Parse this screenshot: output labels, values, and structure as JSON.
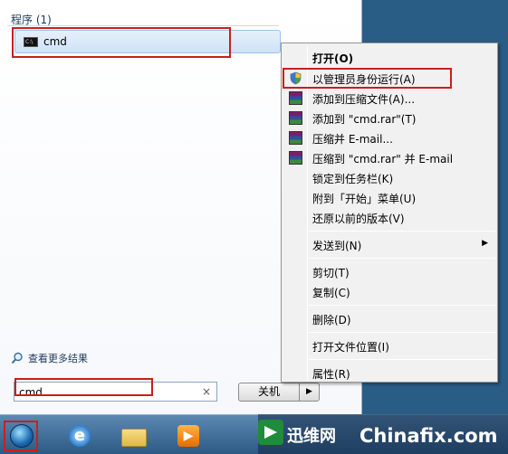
{
  "start_menu": {
    "programs_header": "程序 (1)",
    "program_item": {
      "icon_text": "C:\\",
      "label": "cmd"
    },
    "more_results": "查看更多结果",
    "search": {
      "value": "cmd",
      "clear": "×"
    },
    "shutdown": {
      "label": "关机",
      "arrow": "▶"
    }
  },
  "context_menu": {
    "items": [
      {
        "label": "打开(O)",
        "icon": "",
        "bold": true
      },
      {
        "label": "以管理员身份运行(A)",
        "icon": "shield-icon"
      },
      {
        "label": "添加到压缩文件(A)...",
        "icon": "winrar-icon"
      },
      {
        "label": "添加到 \"cmd.rar\"(T)",
        "icon": "winrar-icon"
      },
      {
        "label": "压缩并 E-mail...",
        "icon": "winrar-icon"
      },
      {
        "label": "压缩到 \"cmd.rar\" 并 E-mail",
        "icon": "winrar-icon"
      },
      {
        "label": "锁定到任务栏(K)",
        "icon": ""
      },
      {
        "label": "附到「开始」菜单(U)",
        "icon": ""
      },
      {
        "label": "还原以前的版本(V)",
        "icon": ""
      },
      {
        "label": "发送到(N)",
        "icon": "",
        "submenu": "▶"
      },
      {
        "label": "剪切(T)",
        "icon": ""
      },
      {
        "label": "复制(C)",
        "icon": ""
      },
      {
        "label": "删除(D)",
        "icon": ""
      },
      {
        "label": "打开文件位置(I)",
        "icon": ""
      },
      {
        "label": "属性(R)",
        "icon": ""
      }
    ]
  },
  "taskbar": {
    "ie_glyph": "e",
    "media_glyph": "▶"
  },
  "watermark": {
    "brand_cn": "迅维网",
    "brand_en": "Chinafix.com"
  },
  "colors": {
    "highlight_box": "#c8201d",
    "taskbar": "#2c5a84"
  }
}
